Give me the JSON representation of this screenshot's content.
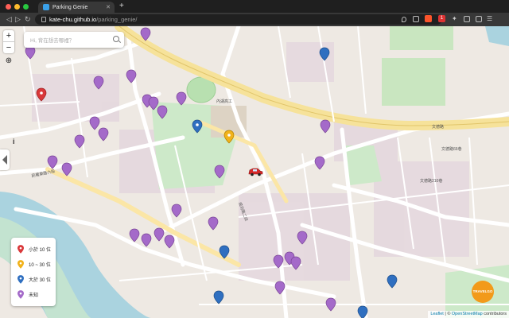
{
  "browser": {
    "tab_title": "Parking Genie",
    "new_tab": "+",
    "url_host": "kate-chu.github.io",
    "url_path": "/parking_genie/",
    "colors": {
      "close": "#ff5f57",
      "minimize": "#febc2e",
      "maximize": "#28c840",
      "brave": "#fb542b"
    },
    "badge_count": "1"
  },
  "map": {
    "zoom_in": "+",
    "zoom_out": "−",
    "search_placeholder": "Hi, 背在想去哪裡？",
    "info": "i",
    "attribution_leaflet": "Leaflet",
    "attribution_sep": " | © ",
    "attribution_osm": "OpenStreetMap",
    "attribution_tail": " contributors",
    "logo_text": "TRAVELGO",
    "legend": [
      {
        "label": "小於 10 位",
        "color": "#d9383a"
      },
      {
        "label": "10 ~ 30 位",
        "color": "#f1b21a"
      },
      {
        "label": "大於 30 位",
        "color": "#2f6fc0"
      },
      {
        "label": "未知",
        "color": "#a46ac9"
      }
    ],
    "street_labels": [
      "內湖高工",
      "文德路",
      "文德路66巷",
      "民權東路六段",
      "成功路二段",
      "文德路210巷"
    ]
  }
}
